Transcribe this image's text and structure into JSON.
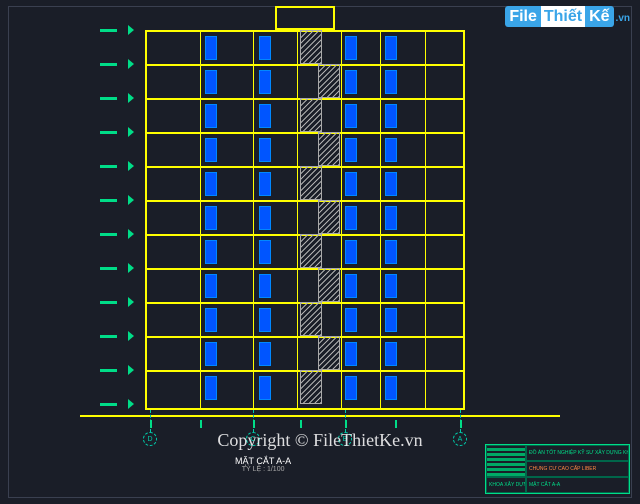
{
  "watermark": {
    "file": "File",
    "thiet": "Thiết",
    "ke": "Kế",
    "vn": ".vn"
  },
  "copyright": "Copyright © FileThietKe.vn",
  "drawing": {
    "title": "MẶT CẮT A-A",
    "scale": "TỶ LỆ : 1/100",
    "floor_count": 11,
    "column_positions": [
      0,
      55,
      108,
      152,
      196,
      235,
      280,
      320
    ],
    "blue_panel_columns": [
      60,
      114,
      200,
      240
    ],
    "grid_labels": [
      "D",
      "C",
      "B",
      "A"
    ],
    "floor_height_approx": 34
  },
  "title_panel": {
    "row1": "ĐỒ ÁN TỐT NGHIỆP KỸ SƯ XÂY DỰNG KHÓA",
    "row2": "CHUNG CƯ CAO CẤP LIBER",
    "row3_left": "KHOA XÂY DỰNG",
    "row3_right": "MẶT CẮT A-A"
  }
}
